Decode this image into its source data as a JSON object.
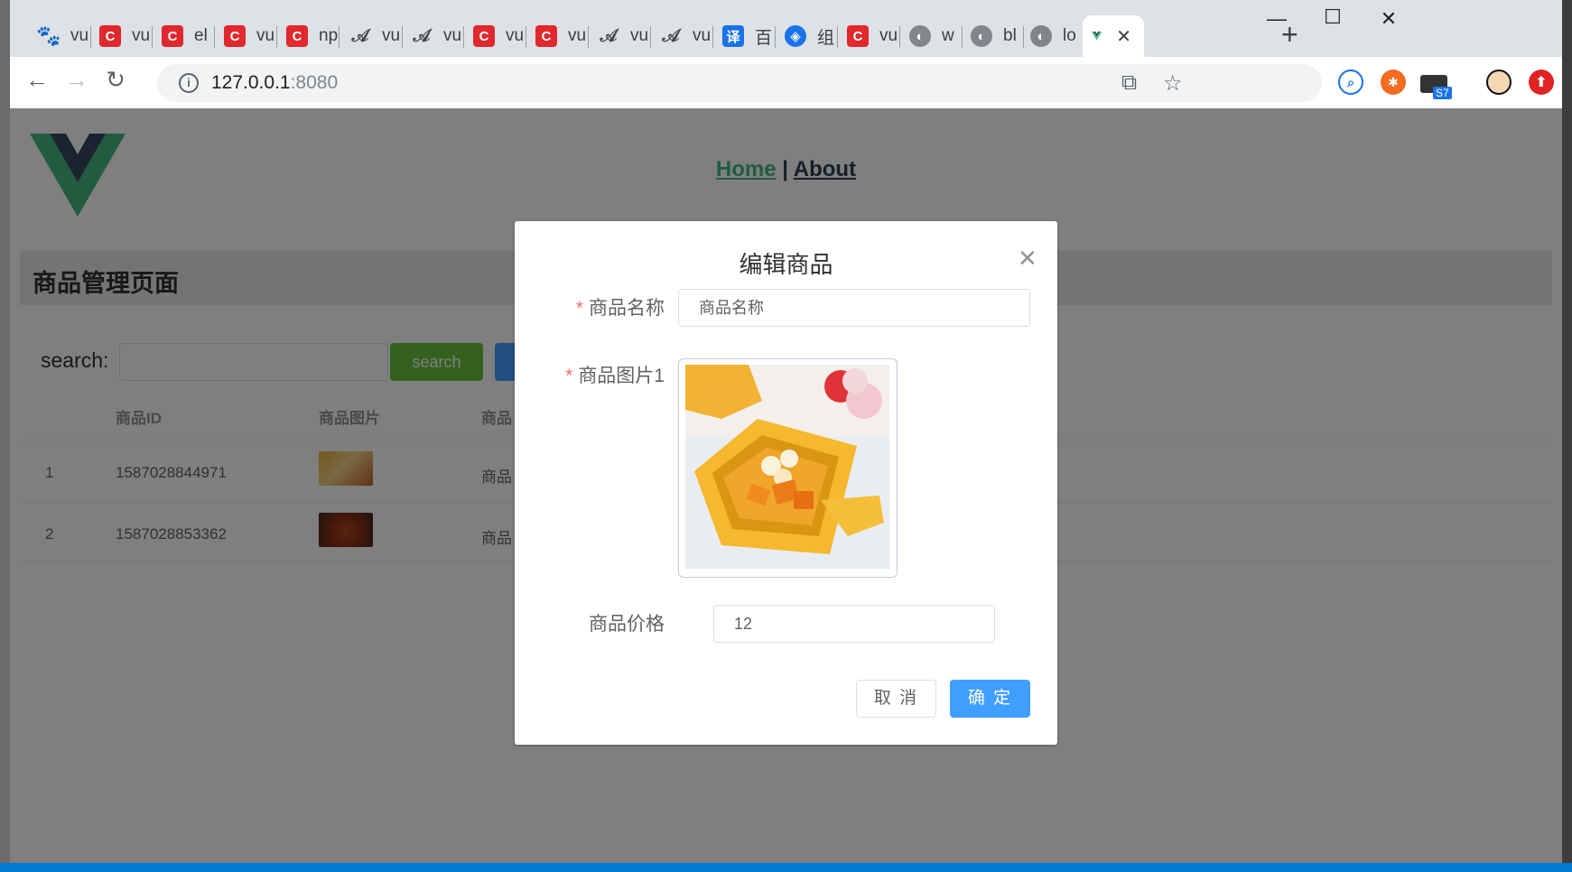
{
  "browser": {
    "tabs": [
      {
        "icon": "baidu-paw-icon",
        "label": "vu"
      },
      {
        "icon": "csdn-icon",
        "label": "vu"
      },
      {
        "icon": "csdn-icon",
        "label": "el"
      },
      {
        "icon": "csdn-icon",
        "label": "vu"
      },
      {
        "icon": "csdn-icon",
        "label": "np"
      },
      {
        "icon": "ai-icon",
        "label": "vu"
      },
      {
        "icon": "ai-icon",
        "label": "vu"
      },
      {
        "icon": "csdn-icon",
        "label": "vu"
      },
      {
        "icon": "csdn-icon",
        "label": "vu"
      },
      {
        "icon": "ai-icon",
        "label": "vu"
      },
      {
        "icon": "ai-icon",
        "label": "vu"
      },
      {
        "icon": "translate-icon",
        "label": "百",
        "glyph": "译"
      },
      {
        "icon": "shield-icon",
        "label": "组"
      },
      {
        "icon": "csdn-icon",
        "label": "vu"
      },
      {
        "icon": "globe-icon",
        "label": "w"
      },
      {
        "icon": "globe-icon",
        "label": "bl"
      },
      {
        "icon": "globe-icon",
        "label": "lo"
      }
    ],
    "active_tab_icon": "vue-icon",
    "url_host": "127.0.0.1",
    "url_port": ":8080",
    "extension_badge": "S7"
  },
  "nav": {
    "home": "Home",
    "separator": "|",
    "about": "About"
  },
  "page": {
    "title": "商品管理页面",
    "search_label": "search:",
    "search_button": "search",
    "table": {
      "headers": [
        "商品ID",
        "商品图片",
        "商品"
      ],
      "rows": [
        {
          "index": "1",
          "id": "1587028844971",
          "name": "商品"
        },
        {
          "index": "2",
          "id": "1587028853362",
          "name": "商品"
        }
      ]
    }
  },
  "dialog": {
    "title": "编辑商品",
    "name_label": "商品名称",
    "name_placeholder": "商品名称",
    "image_label": "商品图片1",
    "price_label": "商品价格",
    "price_value": "12",
    "cancel": "取 消",
    "confirm": "确 定"
  },
  "colors": {
    "vue_green": "#42b983",
    "vue_dark": "#35495e",
    "primary": "#409eff",
    "success": "#67c23a",
    "danger": "#f56c6c"
  }
}
